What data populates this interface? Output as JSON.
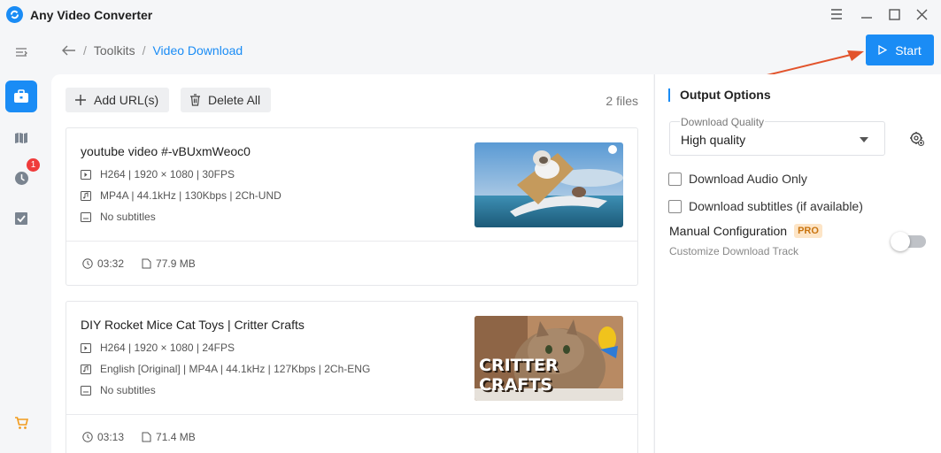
{
  "app": {
    "title": "Any Video Converter"
  },
  "breadcrumb": {
    "root": "Toolkits",
    "current": "Video Download"
  },
  "start_button": {
    "label": "Start"
  },
  "sidebar": {
    "badge_count": "1"
  },
  "toolbar": {
    "add_label": "Add URL(s)",
    "delete_label": "Delete All",
    "file_count": "2 files"
  },
  "files": [
    {
      "title": "youtube video #-vBUxmWeoc0",
      "video": "H264 | 1920 × 1080 | 30FPS",
      "audio": "MP4A | 44.1kHz | 130Kbps | 2Ch-UND",
      "subtitles": "No subtitles",
      "duration": "03:32",
      "size": "77.9 MB"
    },
    {
      "title": "DIY Rocket Mice Cat Toys | Critter Crafts",
      "video": "H264 | 1920 × 1080 | 24FPS",
      "audio": "English [Original] | MP4A | 44.1kHz | 127Kbps | 2Ch-ENG",
      "subtitles": "No subtitles",
      "duration": "03:13",
      "size": "71.4 MB",
      "thumb_text_1": "CRITTER",
      "thumb_text_2": "CRAFTS"
    }
  ],
  "output": {
    "title": "Output Options",
    "quality_label": "Download Quality",
    "quality_value": "High quality",
    "audio_only": "Download Audio Only",
    "subtitles": "Download subtitles (if available)",
    "manual": "Manual Configuration",
    "pro": "PRO",
    "manual_sub": "Customize Download Track"
  },
  "colors": {
    "accent": "#1a8cf5",
    "badge": "#ef3b3b",
    "pro_bg": "#fde5c7",
    "arrow": "#e2532b"
  }
}
